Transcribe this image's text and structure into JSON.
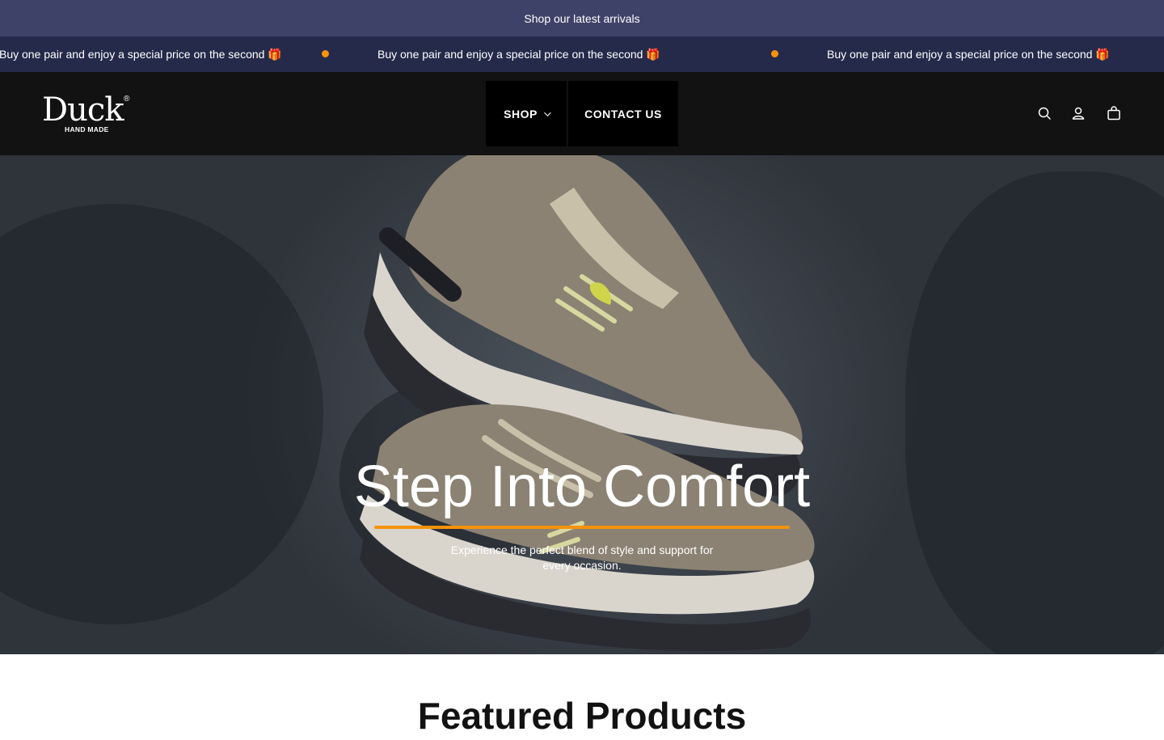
{
  "announcement": {
    "text": "Shop our latest arrivals"
  },
  "marquee": {
    "messages": [
      "Buy one pair and enjoy a special price on the second 🎁",
      "Buy one pair and enjoy a special price on the second 🎁",
      "Buy one pair and enjoy a special price on the second 🎁"
    ]
  },
  "header": {
    "logo": {
      "word": "Duck",
      "mark": "®",
      "sub": "HAND MADE"
    },
    "nav": [
      {
        "label": "Shop"
      },
      {
        "label": "Contact Us"
      }
    ],
    "icons": [
      "search-icon",
      "account-icon",
      "cart-icon"
    ]
  },
  "hero": {
    "title": "Step Into Comfort",
    "subtitle": "Experience the perfect blend of style and support for every occasion."
  },
  "featured": {
    "title": "Featured Products"
  },
  "colors": {
    "announcement_bg": "#3f4268",
    "marquee_bg": "#262a4a",
    "header_bg": "#121212",
    "accent": "#f5930b"
  }
}
